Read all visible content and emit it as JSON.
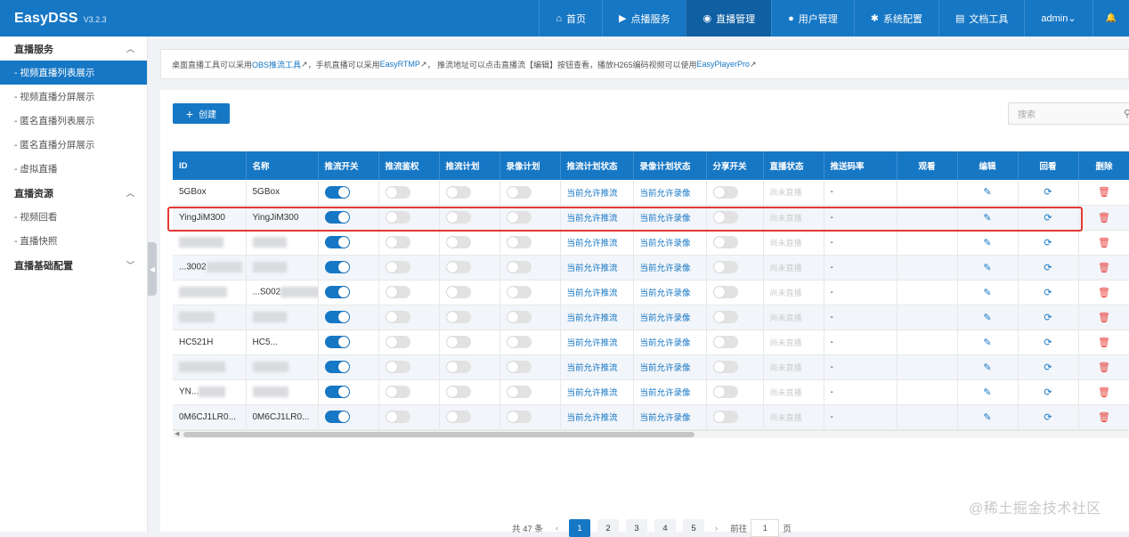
{
  "app": {
    "name": "EasyDSS",
    "version": "V3.2.3"
  },
  "topnav": [
    {
      "icon": "home-icon",
      "glyph": "⌂",
      "label": "首页",
      "active": false
    },
    {
      "icon": "video-icon",
      "glyph": "▶",
      "label": "点播服务",
      "active": false
    },
    {
      "icon": "live-icon",
      "glyph": "◉",
      "label": "直播管理",
      "active": true
    },
    {
      "icon": "user-icon",
      "glyph": "●",
      "label": "用户管理",
      "active": false
    },
    {
      "icon": "gear-icon",
      "glyph": "✱",
      "label": "系统配置",
      "active": false
    },
    {
      "icon": "doc-icon",
      "glyph": "▤",
      "label": "文档工具",
      "active": false
    }
  ],
  "user": {
    "name": "admin"
  },
  "sidebar": {
    "groups": [
      {
        "label": "直播服务",
        "items": [
          "- 视频直播列表展示",
          "- 视频直播分屏展示",
          "- 匿名直播列表展示",
          "- 匿名直播分屏展示",
          "- 虚拟直播"
        ]
      },
      {
        "label": "直播资源",
        "items": [
          "- 视频回看",
          "- 直播快照"
        ]
      },
      {
        "label": "直播基础配置",
        "items": []
      }
    ],
    "active_item": "- 视频直播列表展示"
  },
  "notice": {
    "t1": "桌面直播工具可以采用 ",
    "l1": "OBS推流工具",
    "t2": "，手机直播可以采用 ",
    "l2": "EasyRTMP",
    "t3": "， 推流地址可以点击直播流【编辑】按钮查看，播放H265编码视频可以使用 ",
    "l3": "EasyPlayerPro"
  },
  "toolbar": {
    "create_label": "创建",
    "search_placeholder": "搜索"
  },
  "table": {
    "headers": [
      "ID",
      "名称",
      "推流开关",
      "推流鉴权",
      "推流计划",
      "录像计划",
      "推流计划状态",
      "录像计划状态",
      "分享开关",
      "直播状态",
      "推送码率",
      "观看",
      "编辑",
      "回看",
      "删除"
    ],
    "rows": [
      {
        "id": "5GBox",
        "name": "5GBox",
        "push": true
      },
      {
        "id": "YingJiM300",
        "name": "YingJiM300",
        "push": true
      },
      {
        "id": "",
        "name": "",
        "push": true
      },
      {
        "id": "...3002",
        "name": "",
        "push": true
      },
      {
        "id": "",
        "name": "...S002",
        "push": true
      },
      {
        "id": "",
        "name": "",
        "push": true
      },
      {
        "id": "HC521H",
        "name": "HC5...",
        "push": true
      },
      {
        "id": "",
        "name": "",
        "push": true
      },
      {
        "id": "YN...",
        "name": "",
        "push": true
      },
      {
        "id": "0M6CJ1LR0...",
        "name": "0M6CJ1LR0...",
        "push": true
      }
    ],
    "push_plan_status": "当前允许推流",
    "record_plan_status": "当前允许录像",
    "live_status": "尚未直播",
    "bitrate": "-"
  },
  "pagination": {
    "total": "共 47 条",
    "pages": [
      "1",
      "2",
      "3",
      "4",
      "5"
    ],
    "active": "1",
    "goto_label": "前往",
    "goto_value": "1",
    "page_suffix": "页"
  },
  "watermark": "@稀土掘金技术社区",
  "colors": {
    "primary": "#1677c5",
    "danger": "#e8423e",
    "highlight": "#e53935"
  }
}
